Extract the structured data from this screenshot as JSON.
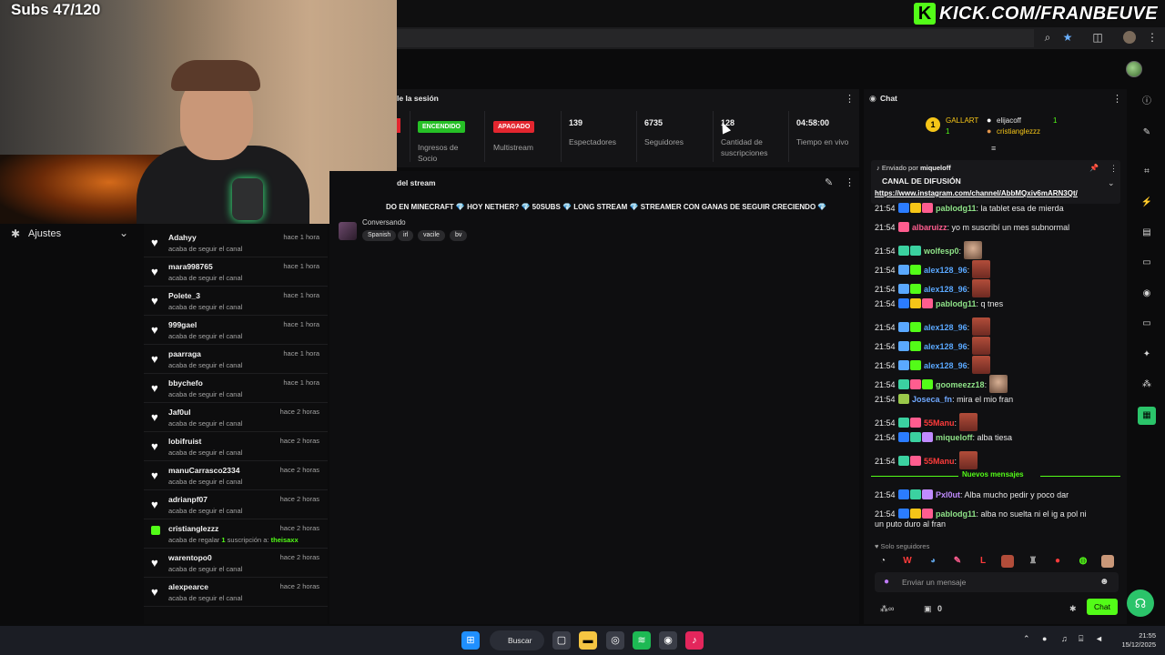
{
  "overlay": {
    "subs_counter": "Subs 47/120",
    "kick_logo": "K",
    "kick_url": "KICK.COM/FRANBEUVE"
  },
  "settings": {
    "label": "Ajustes",
    "icon": "gear-icon"
  },
  "feed": {
    "items": [
      {
        "user": "Adahyy",
        "action": "acaba de seguir el canal",
        "time": "hace 1 hora",
        "type": "follow"
      },
      {
        "user": "mara998765",
        "action": "acaba de seguir el canal",
        "time": "hace 1 hora",
        "type": "follow"
      },
      {
        "user": "Polete_3",
        "action": "acaba de seguir el canal",
        "time": "hace 1 hora",
        "type": "follow"
      },
      {
        "user": "999gael",
        "action": "acaba de seguir el canal",
        "time": "hace 1 hora",
        "type": "follow"
      },
      {
        "user": "paarraga",
        "action": "acaba de seguir el canal",
        "time": "hace 1 hora",
        "type": "follow"
      },
      {
        "user": "bbychefo",
        "action": "acaba de seguir el canal",
        "time": "hace 1 hora",
        "type": "follow"
      },
      {
        "user": "Jaf0ul",
        "action": "acaba de seguir el canal",
        "time": "hace 2 horas",
        "type": "follow"
      },
      {
        "user": "lobifruist",
        "action": "acaba de seguir el canal",
        "time": "hace 2 horas",
        "type": "follow"
      },
      {
        "user": "manuCarrasco2334",
        "action": "acaba de seguir el canal",
        "time": "hace 2 horas",
        "type": "follow"
      },
      {
        "user": "adrianpf07",
        "action": "acaba de seguir el canal",
        "time": "hace 2 horas",
        "type": "follow"
      },
      {
        "user": "cristianglezzz",
        "action": "acaba de regalar",
        "count": "1",
        "action2": "suscripción a:",
        "target": "theisaxx",
        "time": "hace 2 horas",
        "type": "gift"
      },
      {
        "user": "warentopo0",
        "action": "acaba de seguir el canal",
        "time": "hace 2 horas",
        "type": "follow"
      },
      {
        "user": "alexpearce",
        "action": "acaba de seguir el canal",
        "time": "hace 2 horas",
        "type": "follow"
      }
    ]
  },
  "session": {
    "title": "le la sesión",
    "partner_status": "ENCENDIDO",
    "partner_label": "Ingresos de Socio",
    "multistream_status": "APAGADO",
    "multistream_label": "Multistream",
    "viewers": "139",
    "viewers_label": "Espectadores",
    "followers": "6735",
    "followers_label": "Seguidores",
    "subs": "128",
    "subs_label": "Cantidad de suscripciones",
    "uptime": "04:58:00",
    "uptime_label": "Tiempo en vivo"
  },
  "stream": {
    "title": "del stream",
    "text": "DO EN MINECRAFT 💎 HOY NETHER? 💎 50SUBS 💎 LONG STREAM 💎 STREAMER CON GANAS DE SEGUIR CRECIENDO 💎",
    "category": "Conversando",
    "tags": [
      "Spanish",
      "irl",
      "vacile",
      "bv"
    ]
  },
  "chat": {
    "title": "Chat",
    "leaderboard": {
      "rank": "1",
      "first": "GALLART",
      "first_count": "1",
      "second": "elijacoff",
      "second_count": "1",
      "third": "cristianglezzz"
    },
    "pinned": {
      "by_label": "Enviado por",
      "by_user": "miqueloff",
      "channel": "CANAL DE DIFUSIÓN",
      "link": "https://www.instagram.com/channel/AbbMQxiv6mARN3Qt/"
    },
    "messages": [
      {
        "time": "21:54",
        "user": "pablodg11",
        "color": "#8fe388",
        "text": ": la tablet esa de mierda"
      },
      {
        "time": "21:54",
        "user": "albaruizz",
        "color": "#ff5d8f",
        "text": ": yo m suscribí un mes subnormal"
      },
      {
        "time": "21:54",
        "user": "wolfesp0",
        "color": "#8fe388",
        "text": ":"
      },
      {
        "time": "21:54",
        "user": "alex128_96",
        "color": "#5aa8ff",
        "text": ":"
      },
      {
        "time": "21:54",
        "user": "alex128_96",
        "color": "#5aa8ff",
        "text": ":"
      },
      {
        "time": "21:54",
        "user": "pablodg11",
        "color": "#8fe388",
        "text": ": q tnes"
      },
      {
        "time": "21:54",
        "user": "alex128_96",
        "color": "#5aa8ff",
        "text": ":"
      },
      {
        "time": "21:54",
        "user": "alex128_96",
        "color": "#5aa8ff",
        "text": ":"
      },
      {
        "time": "21:54",
        "user": "alex128_96",
        "color": "#5aa8ff",
        "text": ":"
      },
      {
        "time": "21:54",
        "user": "goomeezz18",
        "color": "#8fe388",
        "text": ":"
      },
      {
        "time": "21:54",
        "user": "Joseca_fn",
        "color": "#6fa8ff",
        "text": ": mira el mio fran"
      },
      {
        "time": "21:54",
        "user": "55Manu",
        "color": "#ff3b3b",
        "text": ":"
      },
      {
        "time": "21:54",
        "user": "miqueloff",
        "color": "#8fe388",
        "text": ": alba tiesa"
      },
      {
        "time": "21:54",
        "user": "55Manu",
        "color": "#ff3b3b",
        "text": ":"
      }
    ],
    "new_messages_label": "Nuevos mensajes",
    "new_messages": [
      {
        "time": "21:54",
        "user": "Pxl0ut",
        "color": "#c08bff",
        "text": ": Alba mucho pedir y poco dar"
      },
      {
        "time": "21:54",
        "user": "pablodg11",
        "color": "#8fe388",
        "text": ": alba no suelta ni el ig a pol ni",
        "text2": "un puto duro al fran"
      }
    ],
    "followers_only": "Solo seguidores",
    "input_placeholder": "Enviar un mensaje",
    "bottom_count": "0",
    "send_label": "Chat"
  },
  "taskbar": {
    "search": "Buscar",
    "time": "21:55",
    "date": "15/12/2025"
  },
  "colors": {
    "kick_green": "#53fc18",
    "enc": "#26c026",
    "apag": "#e3262f"
  }
}
